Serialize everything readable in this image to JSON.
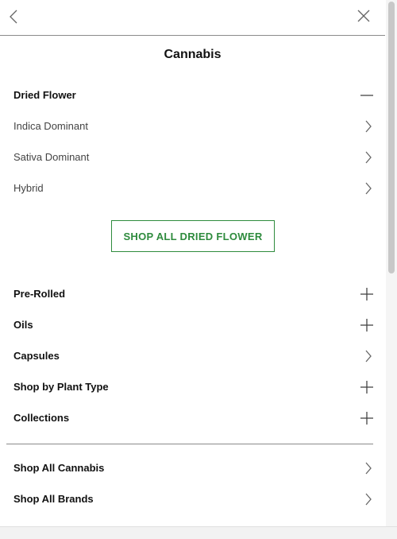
{
  "header": {
    "back_icon": "chevron-left-icon",
    "close_icon": "close-icon",
    "title": "Cannabis"
  },
  "expanded_section": {
    "label": "Dried Flower",
    "icon": "minus-icon",
    "sub_items": [
      {
        "label": "Indica Dominant",
        "icon": "chevron-right-icon"
      },
      {
        "label": "Sativa Dominant",
        "icon": "chevron-right-icon"
      },
      {
        "label": "Hybrid",
        "icon": "chevron-right-icon"
      }
    ],
    "shop_all_label": "SHOP ALL DRIED FLOWER"
  },
  "sections": [
    {
      "label": "Pre-Rolled",
      "icon": "plus-icon"
    },
    {
      "label": "Oils",
      "icon": "plus-icon"
    },
    {
      "label": "Capsules",
      "icon": "chevron-right-icon"
    },
    {
      "label": "Shop by Plant Type",
      "icon": "plus-icon"
    },
    {
      "label": "Collections",
      "icon": "plus-icon"
    }
  ],
  "footer_links": [
    {
      "label": "Shop All Cannabis",
      "icon": "chevron-right-icon"
    },
    {
      "label": "Shop All Brands",
      "icon": "chevron-right-icon"
    }
  ],
  "colors": {
    "accent_green": "#2e8b3d",
    "divider": "#8a8a8a"
  }
}
